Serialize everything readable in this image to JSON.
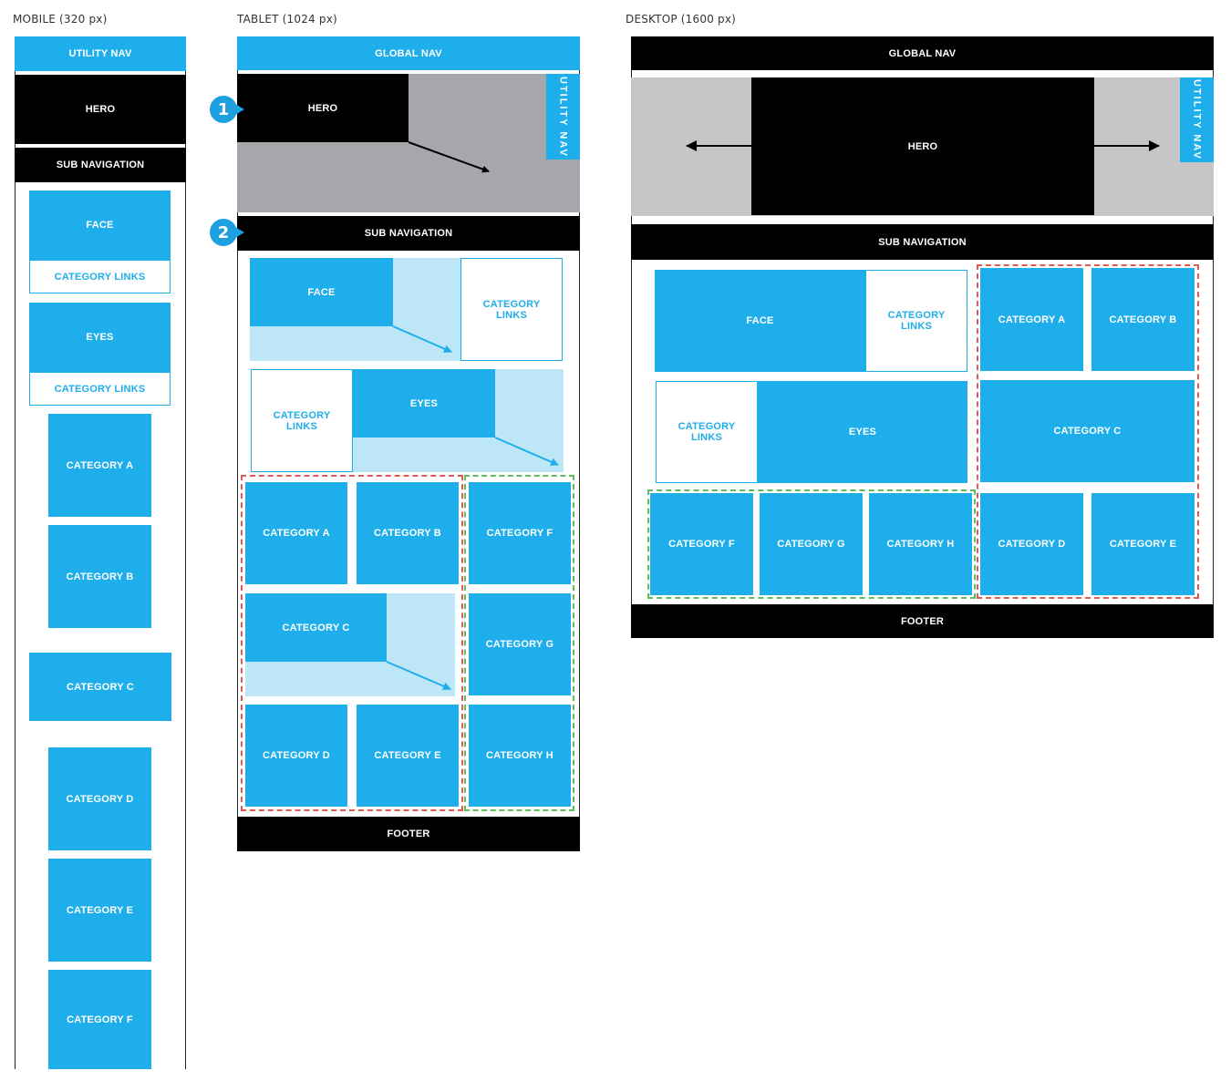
{
  "mobile": {
    "caption": "MOBILE (320 px)",
    "utility_nav": "UTILITY NAV",
    "hero": "HERO",
    "sub_navigation": "SUB NAVIGATION",
    "face": "FACE",
    "face_links": "CATEGORY LINKS",
    "eyes": "EYES",
    "eyes_links": "CATEGORY LINKS",
    "categories": [
      "CATEGORY A",
      "CATEGORY B",
      "CATEGORY C",
      "CATEGORY D",
      "CATEGORY E",
      "CATEGORY F"
    ]
  },
  "tablet": {
    "caption": "TABLET (1024 px)",
    "global_nav": "GLOBAL NAV",
    "hero": "HERO",
    "utility_nav": "UTILITY NAV",
    "sub_navigation": "SUB NAVIGATION",
    "badges": [
      "1",
      "2"
    ],
    "face": "FACE",
    "face_links": "CATEGORY LINKS",
    "eyes": "EYES",
    "eyes_links": "CATEGORY LINKS",
    "categories": [
      "CATEGORY A",
      "CATEGORY B",
      "CATEGORY F",
      "CATEGORY C",
      "CATEGORY G",
      "CATEGORY D",
      "CATEGORY E",
      "CATEGORY H"
    ],
    "footer": "FOOTER"
  },
  "desktop": {
    "caption": "DESKTOP (1600 px)",
    "global_nav": "GLOBAL NAV",
    "hero": "HERO",
    "utility_nav": "UTILITY NAV",
    "sub_navigation": "SUB NAVIGATION",
    "face": "FACE",
    "face_links": "CATEGORY LINKS",
    "eyes": "EYES",
    "eyes_links": "CATEGORY LINKS",
    "categories": [
      "CATEGORY A",
      "CATEGORY B",
      "CATEGORY C",
      "CATEGORY F",
      "CATEGORY G",
      "CATEGORY H",
      "CATEGORY D",
      "CATEGORY E"
    ],
    "footer": "FOOTER"
  },
  "colors": {
    "blue": "#1eaeeb",
    "black": "#000000",
    "light_blue": "#bde6f7",
    "grey": "#a6a7aa",
    "red_dash": "#e05a55",
    "green_dash": "#5fbd5f"
  }
}
